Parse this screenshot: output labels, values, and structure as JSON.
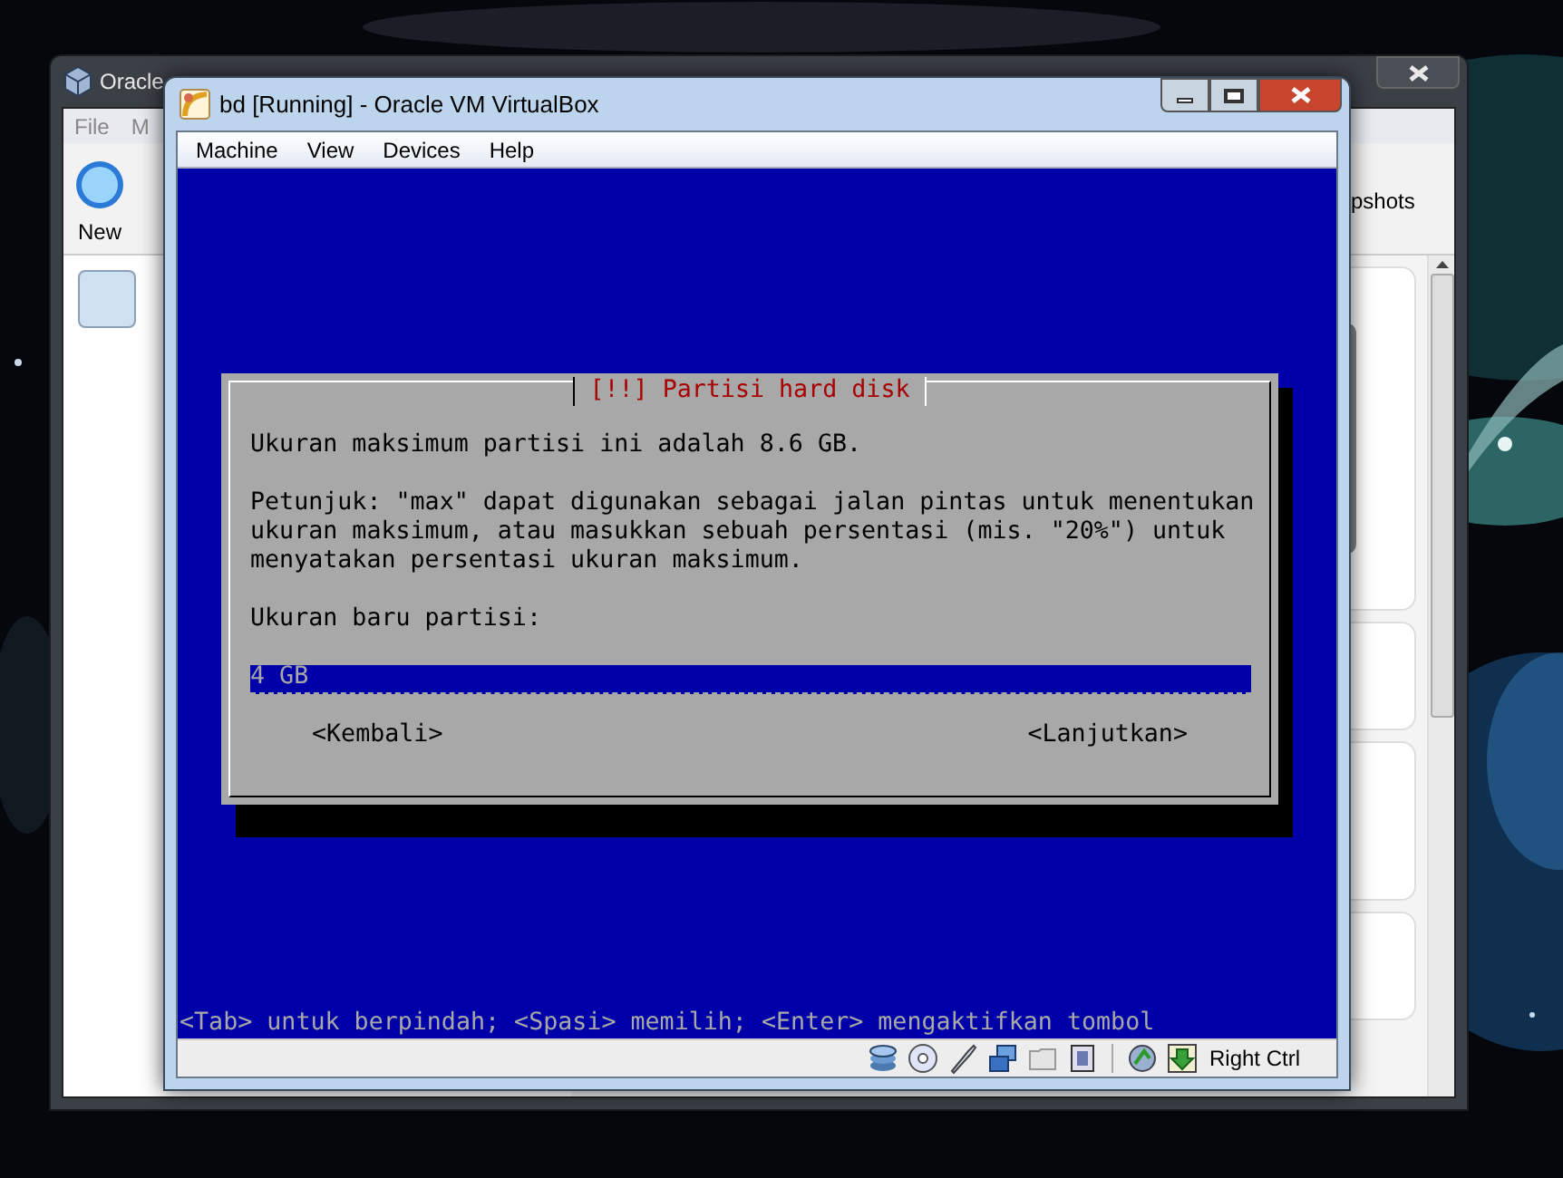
{
  "manager_window": {
    "title": "Oracle",
    "menu": [
      "File",
      "M"
    ],
    "toolbar": [
      {
        "label": "New"
      }
    ],
    "toolbar_cut_label": "pshots"
  },
  "vm_window": {
    "title": "bd [Running] - Oracle VM VirtualBox",
    "menu": [
      "Machine",
      "View",
      "Devices",
      "Help"
    ],
    "dialog": {
      "title": "[!!] Partisi hard disk",
      "paragraphs": [
        "Ukuran maksimum partisi ini adalah 8.6 GB.",
        "Petunjuk: \"max\" dapat digunakan sebagai jalan pintas untuk menentukan ukuran maksimum, atau masukkan sebuah persentasi (mis. \"20%\") untuk menyatakan persentasi ukuran maksimum."
      ],
      "prompt": "Ukuran baru partisi:",
      "input": {
        "value": "4 GB"
      },
      "buttons": [
        "<Kembali>",
        "<Lanjutkan>"
      ]
    },
    "help_line": "<Tab> untuk berpindah; <Spasi> memilih; <Enter> mengaktifkan tombol",
    "status_bar": {
      "host_key": "Right Ctrl"
    }
  }
}
